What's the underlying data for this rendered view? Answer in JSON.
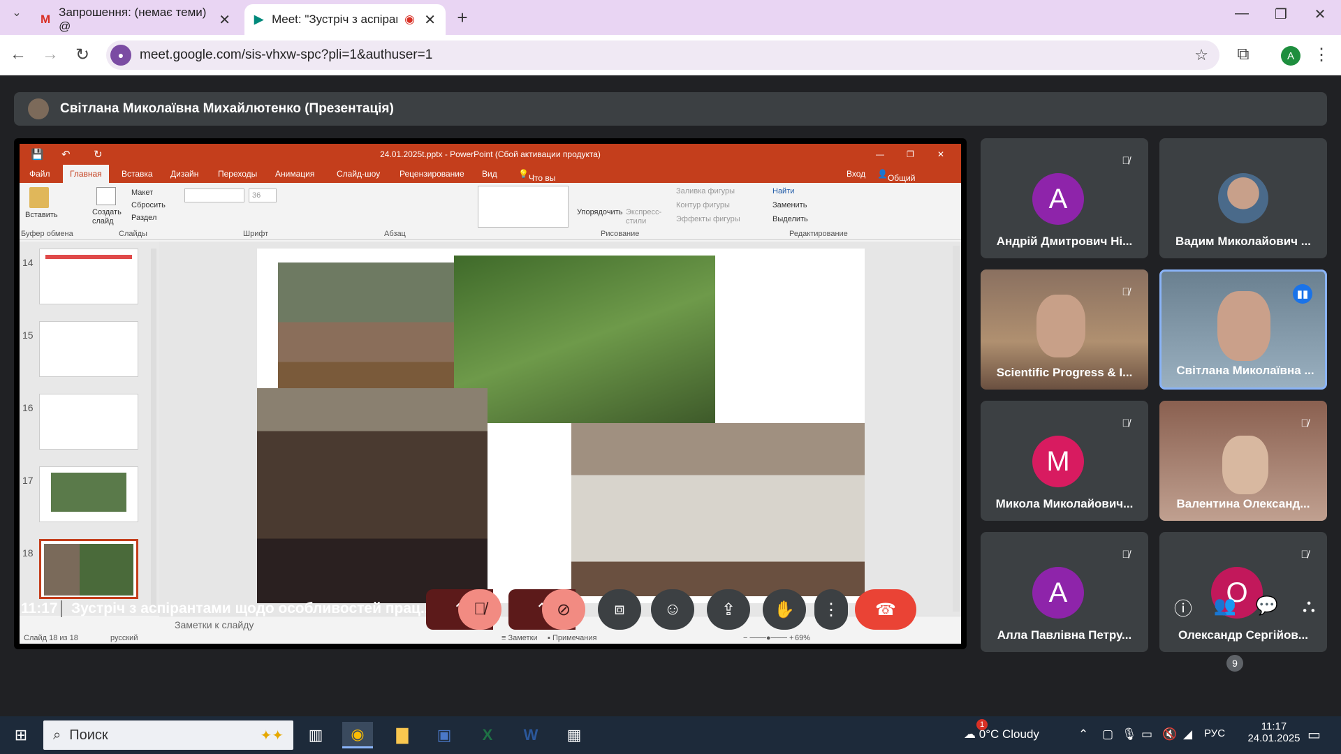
{
  "browser": {
    "tabs": [
      {
        "title": "Запрошення: (немає теми) @",
        "icon": "gmail-icon"
      },
      {
        "title": "Meet: \"Зустріч з аспіранта",
        "icon": "meet-icon"
      }
    ],
    "url": "meet.google.com/sis-vhxw-spc?pli=1&authuser=1",
    "profile_initial": "A"
  },
  "meet": {
    "presenter_banner": "Світлана Миколаївна Михайлютенко (Презентація)",
    "participants": [
      {
        "name": "Андрій Дмитрович Ні...",
        "initial": "A",
        "color": "#8e24aa",
        "muted": true,
        "video": false
      },
      {
        "name": "Вадим Миколайович ...",
        "initial": "",
        "color": "",
        "muted": false,
        "video": true
      },
      {
        "name": "Scientific Progress & I...",
        "initial": "",
        "color": "",
        "muted": true,
        "video": true
      },
      {
        "name": "Світлана Миколаївна ...",
        "initial": "",
        "color": "",
        "muted": false,
        "video": true,
        "speaking": true
      },
      {
        "name": "Микола Миколайович...",
        "initial": "M",
        "color": "#d81b60",
        "muted": true,
        "video": false
      },
      {
        "name": "Валентина Олександ...",
        "initial": "",
        "color": "",
        "muted": true,
        "video": true
      },
      {
        "name": "Алла Павлівна Петру...",
        "initial": "A",
        "color": "#8e24aa",
        "muted": true,
        "video": false
      },
      {
        "name": "Олександр Сергійов...",
        "initial": "O",
        "color": "#c2185b",
        "muted": true,
        "video": false
      }
    ],
    "time": "11:17",
    "meeting_title": "Зустріч з аспірантами щодо особливостей прац...",
    "participant_count": "9"
  },
  "ppt": {
    "title": "24.01.2025t.pptx - PowerPoint (Сбой активации продукта)",
    "tabs": [
      "Файл",
      "Главная",
      "Вставка",
      "Дизайн",
      "Переходы",
      "Анимация",
      "Слайд-шоу",
      "Рецензирование",
      "Вид"
    ],
    "tellme": "Что вы хотите сделать?",
    "signin": "Вход",
    "share": "Общий доступ",
    "ribbon": {
      "paste": "Вставить",
      "new_slide": "Создать слайд",
      "layout": "Макет",
      "reset": "Сбросить",
      "section": "Раздел",
      "font_size": "36",
      "arrange": "Упорядочить",
      "express": "Экспресс-стили",
      "fill": "Заливка фигуры",
      "outline": "Контур фигуры",
      "effects": "Эффекты фигуры",
      "find": "Найти",
      "replace": "Заменить",
      "select": "Выделить",
      "groups": [
        "Буфер обмена",
        "Слайды",
        "Шрифт",
        "Абзац",
        "Рисование",
        "Редактирование"
      ]
    },
    "thumbnails": [
      "14",
      "15",
      "16",
      "17",
      "18"
    ],
    "notes": "Заметки к слайду",
    "status_left": "Слайд 18 из 18",
    "language": "русский",
    "notes_btn": "Заметки",
    "comments_btn": "Примечания",
    "zoom": "69%"
  },
  "taskbar": {
    "search": "Поиск",
    "weather": "0°C Cloudy",
    "lang": "РУС",
    "clock_time": "11:17",
    "clock_date": "24.01.2025",
    "weather_badge": "1"
  }
}
